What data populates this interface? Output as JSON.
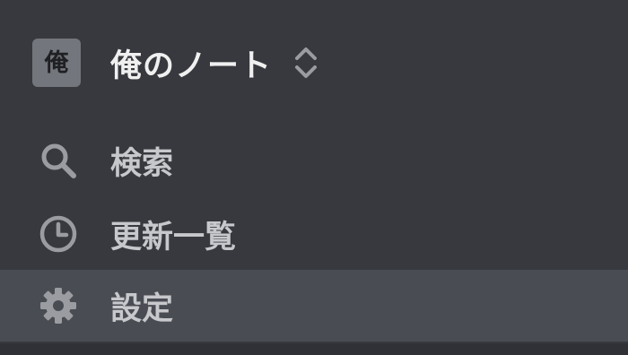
{
  "workspace": {
    "avatar_char": "俺",
    "name": "俺のノート",
    "switcher_icon": "chevron-up-down-icon"
  },
  "nav": {
    "items": [
      {
        "label": "検索",
        "icon": "search-icon",
        "active": false
      },
      {
        "label": "更新一覧",
        "icon": "clock-icon",
        "active": false
      },
      {
        "label": "設定",
        "icon": "gear-icon",
        "active": true
      }
    ]
  },
  "colors": {
    "background": "#37393e",
    "active_item": "#494c52",
    "avatar_bg": "#73767c",
    "text_primary": "#f0f0f0",
    "text_secondary": "#c6c8cc",
    "icon": "#9a9ca1"
  }
}
